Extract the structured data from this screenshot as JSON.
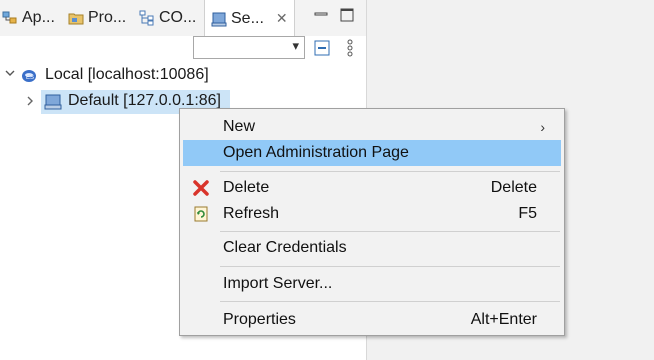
{
  "tabs": [
    {
      "label": "Ap...",
      "icon": "application-icon"
    },
    {
      "label": "Pro...",
      "icon": "folder-icon"
    },
    {
      "label": "CO...",
      "icon": "component-icon"
    },
    {
      "label": "Se...",
      "icon": "server-icon",
      "close": "✕"
    }
  ],
  "window_controls": {
    "minimize": "minimize-icon",
    "maximize": "maximize-icon"
  },
  "toolbar": {
    "combo_value": "",
    "combo_arrow": "▾",
    "collapse_icon": "collapse-all-icon",
    "menu_icon": "view-menu-icon"
  },
  "tree": {
    "root": {
      "label": "Local [localhost:10086]",
      "icon": "local-node-icon",
      "expanded": true
    },
    "child": {
      "label": "Default [127.0.0.1:86]",
      "icon": "server-icon",
      "expanded": false
    }
  },
  "context_menu": {
    "items": [
      {
        "label": "New",
        "accelerator": "",
        "submenu": "›",
        "icon": ""
      },
      {
        "label": "Open Administration Page",
        "accelerator": "",
        "icon": "",
        "highlighted": true
      },
      {
        "label": "Delete",
        "accelerator": "Delete",
        "icon": "delete-icon"
      },
      {
        "label": "Refresh",
        "accelerator": "F5",
        "icon": "refresh-icon"
      },
      {
        "label": "Clear Credentials",
        "accelerator": "",
        "icon": ""
      },
      {
        "label": "Import Server...",
        "accelerator": "",
        "icon": ""
      },
      {
        "label": "Properties",
        "accelerator": "Alt+Enter",
        "icon": ""
      }
    ]
  },
  "colors": {
    "highlight": "#91c9f7",
    "selection": "#cce4f7",
    "delete_red": "#d9342b"
  }
}
